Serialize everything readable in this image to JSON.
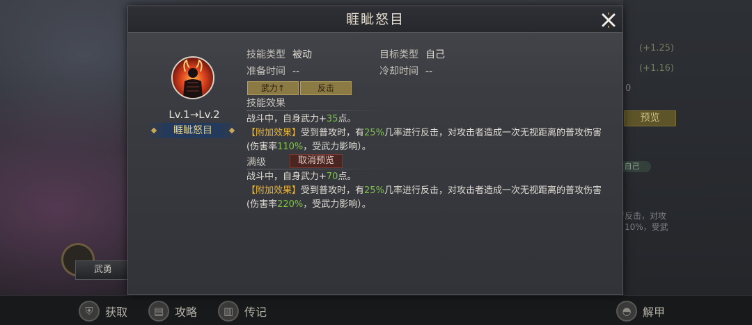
{
  "dialog": {
    "title": "睚眦怒目",
    "close_icon": "close-x-icon",
    "level_text": "Lv.1→Lv.2",
    "skill_name": "睚眦怒目",
    "portrait_icon": "warrior-flame-portrait-icon"
  },
  "skill_info": {
    "type_label": "技能类型",
    "type_value": "被动",
    "target_label": "目标类型",
    "target_value": "自己",
    "prep_label": "准备时间",
    "prep_value": "--",
    "cooldown_label": "冷却时间",
    "cooldown_value": "--"
  },
  "tags": [
    "武力↑",
    "反击"
  ],
  "effect": {
    "label": "技能效果",
    "line1_prefix": "战斗中，自身武力+",
    "line1_value": "35",
    "line1_suffix": "点。",
    "extra_tag": "【附加效果】",
    "extra_a": "受到普攻时，有",
    "extra_chance": "25%",
    "extra_b": "几率进行反击，对攻击者造成一次无视距离的普攻伤害(伤害率",
    "extra_rate": "110%",
    "extra_c": "，受武力影响）。"
  },
  "max_level": {
    "label": "满级",
    "cancel_preview_label": "取消预览",
    "line1_prefix": "战斗中，自身武力+",
    "line1_value": "70",
    "line1_suffix": "点。",
    "extra_tag": "【附加效果】",
    "extra_a": "受到普攻时，有",
    "extra_chance": "25%",
    "extra_b": "几率进行反击，对攻击者造成一次无视距离的普攻伤害(伤害率",
    "extra_rate": "220%",
    "extra_c": "，受武力影响）。"
  },
  "background": {
    "stat1": "(+1.25)",
    "stat2": "(+1.16)",
    "stat3": "0",
    "preview_label": "预览",
    "self_pill": "自己",
    "text_frag1": "行反击，对攻",
    "text_frag2": "10%，受武",
    "badge_label": "武勇"
  },
  "bottom_bar": {
    "acquire_label": "获取",
    "guide_label": "攻略",
    "biography_label": "传记",
    "disarm_label": "解甲"
  },
  "colors": {
    "gold": "#e8b53a",
    "green": "#7fc24a"
  }
}
